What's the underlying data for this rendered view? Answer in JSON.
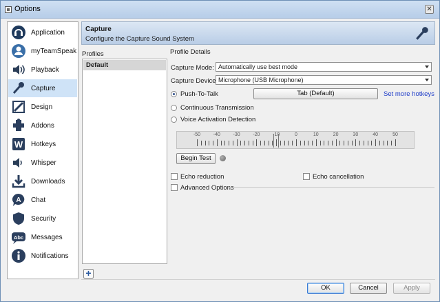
{
  "window": {
    "title": "Options",
    "close_label": "✕"
  },
  "sidebar": {
    "items": [
      {
        "label": "Application",
        "icon": "headset-icon"
      },
      {
        "label": "myTeamSpeak",
        "icon": "user-icon"
      },
      {
        "label": "Playback",
        "icon": "speaker-icon"
      },
      {
        "label": "Capture",
        "icon": "microphone-icon",
        "selected": true
      },
      {
        "label": "Design",
        "icon": "design-icon"
      },
      {
        "label": "Addons",
        "icon": "puzzle-icon"
      },
      {
        "label": "Hotkeys",
        "icon": "keyboard-icon"
      },
      {
        "label": "Whisper",
        "icon": "whisper-icon"
      },
      {
        "label": "Downloads",
        "icon": "download-icon"
      },
      {
        "label": "Chat",
        "icon": "chat-icon"
      },
      {
        "label": "Security",
        "icon": "shield-icon"
      },
      {
        "label": "Messages",
        "icon": "messages-icon"
      },
      {
        "label": "Notifications",
        "icon": "info-icon"
      }
    ]
  },
  "banner": {
    "title": "Capture",
    "subtitle": "Configure the Capture Sound System"
  },
  "profiles": {
    "label": "Profiles",
    "items": [
      "Default"
    ],
    "add_label": "+"
  },
  "details": {
    "label": "Profile Details",
    "capture_mode_label": "Capture Mode:",
    "capture_mode_value": "Automatically use best mode",
    "capture_device_label": "Capture Device:",
    "capture_device_value": "Microphone (USB Microphone)",
    "push_to_talk_label": "Push-To-Talk",
    "hotkey_button": "Tab (Default)",
    "more_hotkeys_link": "Set more hotkeys",
    "continuous_label": "Continuous Transmission",
    "vad_label": "Voice Activation Detection",
    "slider": {
      "tick_labels": [
        "-50",
        "-40",
        "-30",
        "-20",
        "-10",
        "0",
        "10",
        "20",
        "30",
        "40",
        "50"
      ],
      "value": -10
    },
    "begin_test_label": "Begin Test",
    "echo_reduction_label": "Echo reduction",
    "echo_cancellation_label": "Echo cancellation",
    "advanced_options_label": "Advanced Options"
  },
  "footer": {
    "ok_label": "OK",
    "cancel_label": "Cancel",
    "apply_label": "Apply"
  }
}
